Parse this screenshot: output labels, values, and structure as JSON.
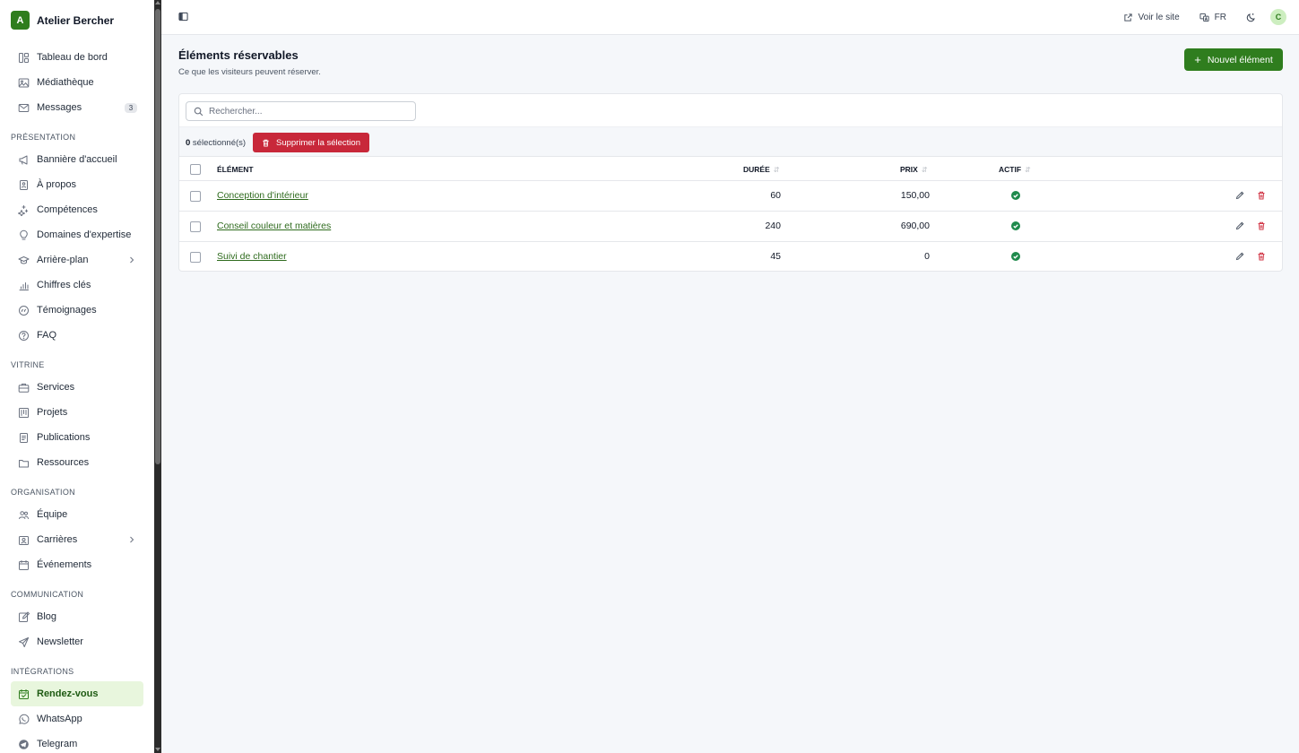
{
  "brand": {
    "initial": "A",
    "name": "Atelier Bercher"
  },
  "sidebar": {
    "top_items": [
      {
        "label": "Tableau de bord",
        "icon": "dashboard-icon"
      },
      {
        "label": "Médiathèque",
        "icon": "image-icon"
      },
      {
        "label": "Messages",
        "icon": "mail-icon",
        "badge": "3"
      }
    ],
    "sections": [
      {
        "title": "PRÉSENTATION",
        "items": [
          {
            "label": "Bannière d'accueil",
            "icon": "megaphone-icon"
          },
          {
            "label": "À propos",
            "icon": "id-card-icon"
          },
          {
            "label": "Compétences",
            "icon": "sparkles-icon"
          },
          {
            "label": "Domaines d'expertise",
            "icon": "lightbulb-icon"
          },
          {
            "label": "Arrière-plan",
            "icon": "graduation-cap-icon",
            "has_children": true
          },
          {
            "label": "Chiffres clés",
            "icon": "bar-chart-icon"
          },
          {
            "label": "Témoignages",
            "icon": "quote-icon"
          },
          {
            "label": "FAQ",
            "icon": "question-icon"
          }
        ]
      },
      {
        "title": "VITRINE",
        "items": [
          {
            "label": "Services",
            "icon": "briefcase-icon"
          },
          {
            "label": "Projets",
            "icon": "kanban-icon"
          },
          {
            "label": "Publications",
            "icon": "document-icon"
          },
          {
            "label": "Ressources",
            "icon": "folder-icon"
          }
        ]
      },
      {
        "title": "ORGANISATION",
        "items": [
          {
            "label": "Équipe",
            "icon": "users-icon"
          },
          {
            "label": "Carrières",
            "icon": "badge-icon",
            "has_children": true
          },
          {
            "label": "Événements",
            "icon": "calendar-icon"
          }
        ]
      },
      {
        "title": "COMMUNICATION",
        "items": [
          {
            "label": "Blog",
            "icon": "pen-square-icon"
          },
          {
            "label": "Newsletter",
            "icon": "send-icon"
          }
        ]
      },
      {
        "title": "INTÉGRATIONS",
        "items": [
          {
            "label": "Rendez-vous",
            "icon": "calendar-check-icon",
            "active": true
          },
          {
            "label": "WhatsApp",
            "icon": "whatsapp-icon"
          },
          {
            "label": "Telegram",
            "icon": "telegram-icon"
          }
        ]
      }
    ]
  },
  "topbar": {
    "view_site": "Voir le site",
    "language": "FR",
    "avatar_initial": "C"
  },
  "page": {
    "title": "Éléments réservables",
    "subtitle": "Ce que les visiteurs peuvent réserver.",
    "new_button": "Nouvel élément",
    "search_placeholder": "Rechercher...",
    "selected_count": "0",
    "selected_suffix": " sélectionné(s)",
    "delete_selection": "Supprimer la sélection"
  },
  "table": {
    "headers": {
      "element": "ÉLÉMENT",
      "duration": "DURÉE",
      "price": "PRIX",
      "active": "ACTIF"
    },
    "rows": [
      {
        "name": "Conception d'intérieur",
        "duration": "60",
        "price": "150,00",
        "active": true
      },
      {
        "name": "Conseil couleur et matières",
        "duration": "240",
        "price": "690,00",
        "active": true
      },
      {
        "name": "Suivi de chantier",
        "duration": "45",
        "price": "0",
        "active": true
      }
    ]
  },
  "colors": {
    "accent": "#2f7d1e",
    "danger": "#c8283a",
    "active_bg": "#e8f6dd"
  }
}
